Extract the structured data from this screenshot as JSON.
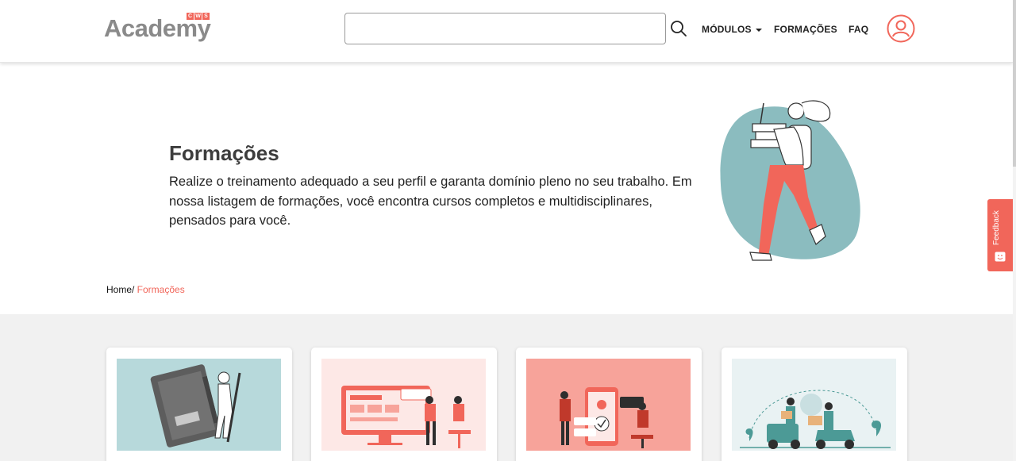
{
  "header": {
    "logo_text": "Academy",
    "logo_badge": [
      "C",
      "W",
      "S"
    ],
    "search_placeholder": "",
    "nav": {
      "modulos": "MÓDULOS",
      "formacoes": "FORMAÇÕES",
      "faq": "FAQ"
    }
  },
  "hero": {
    "title": "Formações",
    "description": "Realize o treinamento adequado a seu perfil e garanta domínio pleno no seu trabalho. Em nossa listagem de formações, você encontra cursos completos e multidisciplinares, pensados para você."
  },
  "breadcrumb": {
    "home": "Home/",
    "current": " Formações"
  },
  "feedback": {
    "label": "Feedback"
  },
  "colors": {
    "accent": "#f1665a",
    "teal": "#8bbcbf",
    "text_dark": "#3d3d3d",
    "cards_bg": "#f1f1f1"
  },
  "cards": [
    {
      "image": "notebook-illustration",
      "bg": "#b7d9db"
    },
    {
      "image": "web-design-illustration",
      "bg": "#fde8e6"
    },
    {
      "image": "mobile-app-illustration",
      "bg": "#f7a39a"
    },
    {
      "image": "delivery-illustration",
      "bg": "#e9f2f3"
    }
  ]
}
